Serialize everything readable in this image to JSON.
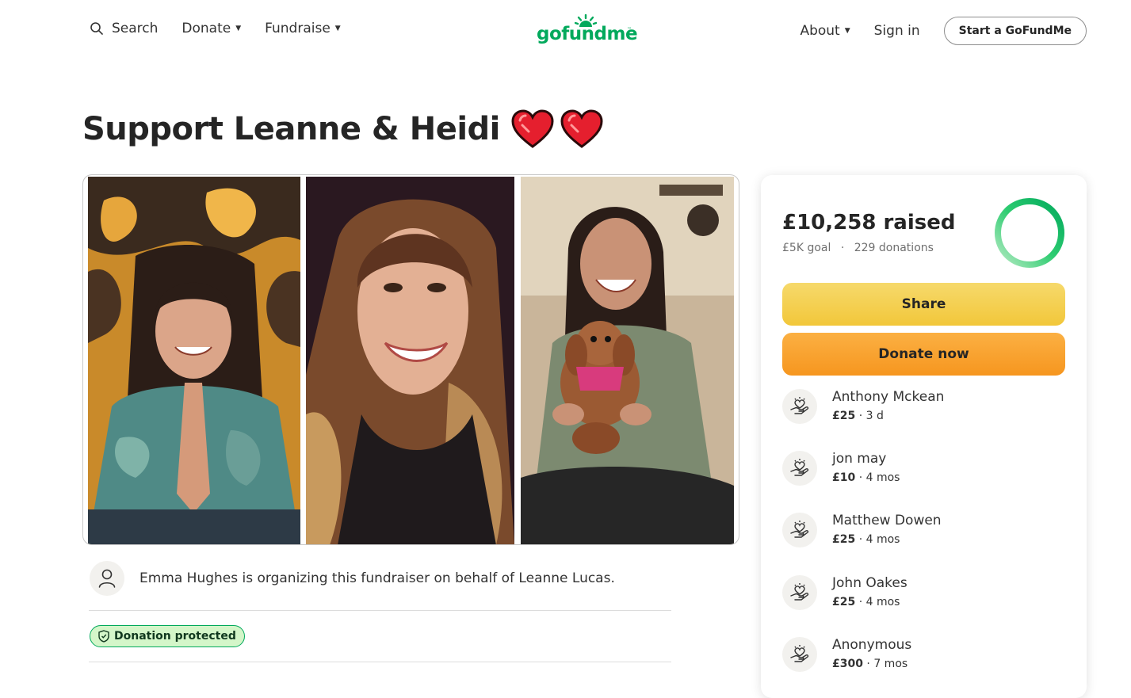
{
  "header": {
    "search_label": "Search",
    "donate_label": "Donate",
    "fundraise_label": "Fundraise",
    "logo_text": "gofundme",
    "about_label": "About",
    "signin_label": "Sign in",
    "start_label": "Start a GoFundMe"
  },
  "page": {
    "title": "Support Leanne & Heidi"
  },
  "organizer": {
    "text": "Emma Hughes is organizing this fundraiser on behalf of Leanne Lucas."
  },
  "badge": {
    "label": "Donation protected"
  },
  "progress": {
    "raised": "£10,258 raised",
    "goal": "£5K goal",
    "separator": "·",
    "donations": "229 donations",
    "fraction": 1.0
  },
  "actions": {
    "share_label": "Share",
    "donate_label": "Donate now"
  },
  "donations": [
    {
      "name": "Anthony Mckean",
      "amount": "£25",
      "time": "· 3 d"
    },
    {
      "name": "jon may",
      "amount": "£10",
      "time": "· 4 mos"
    },
    {
      "name": "Matthew Dowen",
      "amount": "£25",
      "time": "· 4 mos"
    },
    {
      "name": "John Oakes",
      "amount": "£25",
      "time": "· 4 mos"
    },
    {
      "name": "Anonymous",
      "amount": "£300",
      "time": "· 7 mos"
    }
  ],
  "colors": {
    "brand_green": "#02a95c",
    "share_yellow": "#f2c73a",
    "donate_orange": "#f6961f"
  }
}
